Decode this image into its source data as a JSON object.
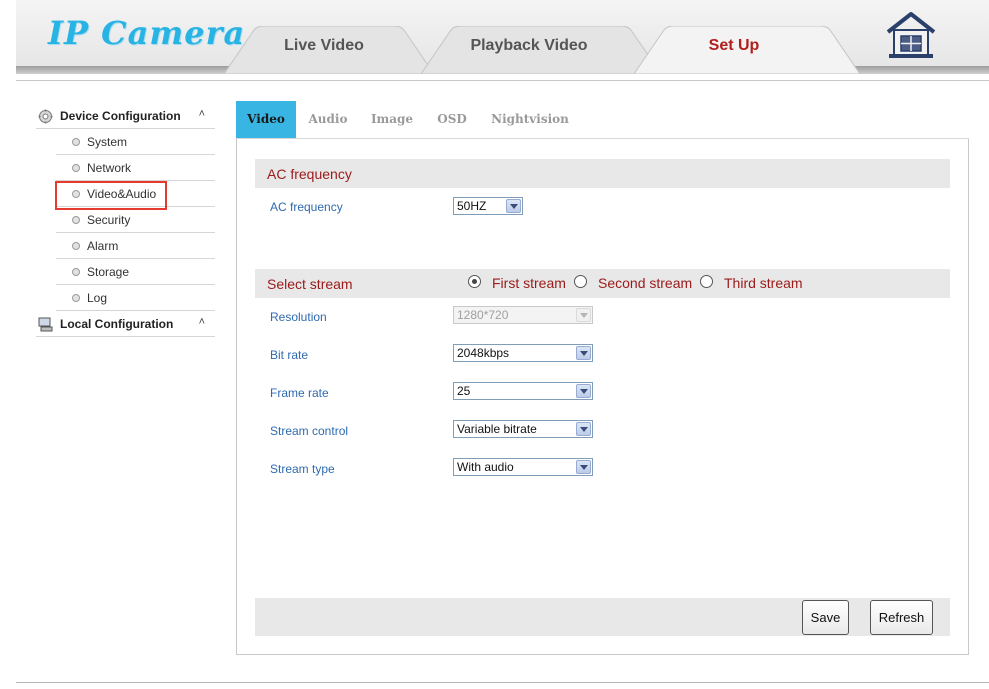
{
  "header": {
    "logo": "IP Camera",
    "tabs": [
      {
        "label": "Live Video",
        "active": false
      },
      {
        "label": "Playback Video",
        "active": false
      },
      {
        "label": "Set Up",
        "active": true
      }
    ],
    "home_icon": "home-icon"
  },
  "sidebar": {
    "groups": [
      {
        "label": "Device Configuration",
        "icon": "gear-icon",
        "caret": "˄",
        "items": [
          "System",
          "Network",
          "Video&Audio",
          "Security",
          "Alarm",
          "Storage",
          "Log"
        ],
        "highlighted": "Video&Audio"
      },
      {
        "label": "Local Configuration",
        "icon": "computer-icon",
        "caret": "˄"
      }
    ]
  },
  "subtabs": [
    {
      "label": "Video",
      "active": true
    },
    {
      "label": "Audio",
      "active": false
    },
    {
      "label": "Image",
      "active": false
    },
    {
      "label": "OSD",
      "active": false
    },
    {
      "label": "Nightvision",
      "active": false
    }
  ],
  "ac_section": {
    "title": "AC frequency",
    "field_label": "AC frequency",
    "value": "50HZ"
  },
  "stream_section": {
    "title": "Select stream",
    "options": [
      "First stream",
      "Second stream",
      "Third stream"
    ],
    "selected": "First stream",
    "fields": [
      {
        "label": "Resolution",
        "value": "1280*720",
        "disabled": true
      },
      {
        "label": "Bit rate",
        "value": "2048kbps",
        "disabled": false
      },
      {
        "label": "Frame rate",
        "value": "25",
        "disabled": false
      },
      {
        "label": "Stream control",
        "value": "Variable bitrate",
        "disabled": false
      },
      {
        "label": "Stream type",
        "value": "With audio",
        "disabled": false
      }
    ]
  },
  "buttons": {
    "save": "Save",
    "refresh": "Refresh"
  },
  "colors": {
    "accent_blue": "#39b5e3",
    "section_title_red": "#9b1a1a",
    "field_label_blue": "#2e6ab0",
    "active_tab_red": "#b0201e",
    "highlight_red": "#e53a30"
  }
}
